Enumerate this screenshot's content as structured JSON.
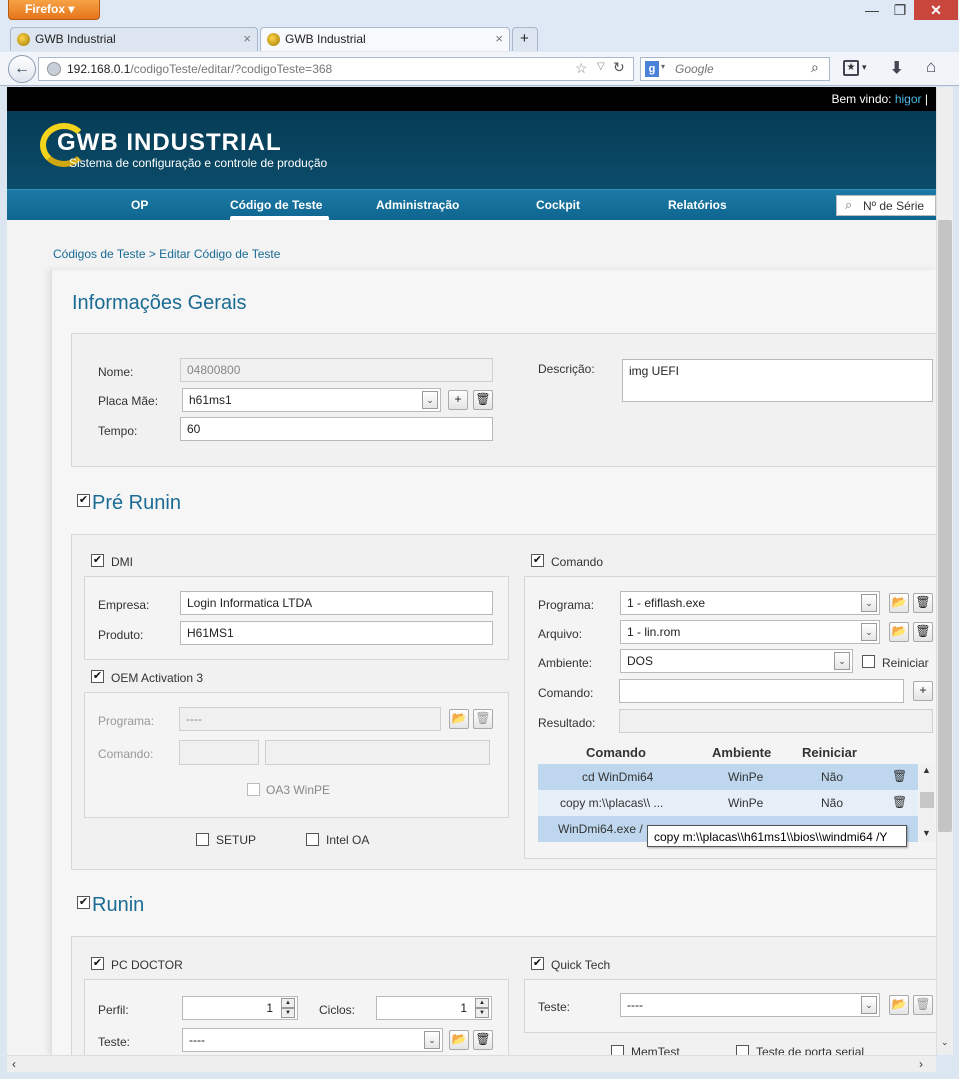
{
  "browser": {
    "firefox_label": "Firefox",
    "tabs": [
      {
        "label": "GWB Industrial",
        "close": "×"
      },
      {
        "label": "GWB Industrial",
        "close": "×"
      }
    ],
    "new_tab": "+",
    "url_host": "192.168.0.1",
    "url_path": "/codigoTeste/editar/?codigoTeste=368",
    "search_placeholder": "Google",
    "window_controls": {
      "minimize": "—",
      "restore": "❐",
      "close": "✕"
    }
  },
  "header": {
    "welcome": "Bem vindo: ",
    "user": "higor",
    "separator": "|",
    "logo_title": "GWB INDUSTRIAL",
    "logo_subtitle": "Sistema de configuração e controle de produção"
  },
  "menu": {
    "items": [
      {
        "label": "OP"
      },
      {
        "label": "Código de Teste"
      },
      {
        "label": "Administração"
      },
      {
        "label": "Cockpit"
      },
      {
        "label": "Relatórios"
      }
    ],
    "active_index": 1,
    "serial_search": "Nº de Série"
  },
  "breadcrumb": "Códigos de Teste > Editar Código de Teste",
  "geral": {
    "title": "Informações Gerais",
    "nome_label": "Nome:",
    "nome_value": "04800800",
    "placa_label": "Placa Mãe:",
    "placa_value": "h61ms1",
    "tempo_label": "Tempo:",
    "tempo_value": "60",
    "descricao_label": "Descrição:",
    "descricao_value": "img UEFI"
  },
  "pre_runin": {
    "title": "Pré Runin",
    "dmi_label": "DMI",
    "empresa_label": "Empresa:",
    "empresa_value": "Login Informatica LTDA",
    "produto_label": "Produto:",
    "produto_value": "H61MS1",
    "oem_label": "OEM Activation 3",
    "oem_programa_label": "Programa:",
    "oem_programa_value": "----",
    "oem_comando_label": "Comando:",
    "oa3_winpe_label": "OA3 WinPE",
    "setup_label": "SETUP",
    "intel_oa_label": "Intel OA",
    "comando_section_label": "Comando",
    "programa_label": "Programa:",
    "programa_value": "1 - efiflash.exe",
    "arquivo_label": "Arquivo:",
    "arquivo_value": "1 - lin.rom",
    "ambiente_label": "Ambiente:",
    "ambiente_value": "DOS",
    "reiniciar_label": "Reiniciar",
    "comando_label": "Comando:",
    "resultado_label": "Resultado:",
    "table": {
      "headers": [
        "Comando",
        "Ambiente",
        "Reiniciar"
      ],
      "rows": [
        {
          "comando": "cd WinDmi64",
          "ambiente": "WinPe",
          "reiniciar": "Não"
        },
        {
          "comando": "copy m:\\\\placas\\\\ ...",
          "ambiente": "WinPe",
          "reiniciar": "Não"
        },
        {
          "comando": "WinDmi64.exe /",
          "ambiente": "",
          "reiniciar": ""
        }
      ]
    },
    "tooltip": "copy m:\\\\placas\\\\h61ms1\\\\bios\\\\windmi64 /Y"
  },
  "runin": {
    "title": "Runin",
    "pcdoctor_label": "PC DOCTOR",
    "perfil_label": "Perfil:",
    "perfil_value": "1",
    "ciclos_label": "Ciclos:",
    "ciclos_value": "1",
    "teste_label": "Teste:",
    "teste_value": "----",
    "quicktech_label": "Quick Tech",
    "qt_teste_label": "Teste:",
    "qt_teste_value": "----",
    "memtest_label": "MemTest",
    "porta_serial_label": "Teste de porta serial"
  },
  "colors": {
    "accent": "#1a6b94",
    "banner": "#0b4c6a",
    "menu": "#1373a0",
    "selected_row": "#bed7ee"
  }
}
